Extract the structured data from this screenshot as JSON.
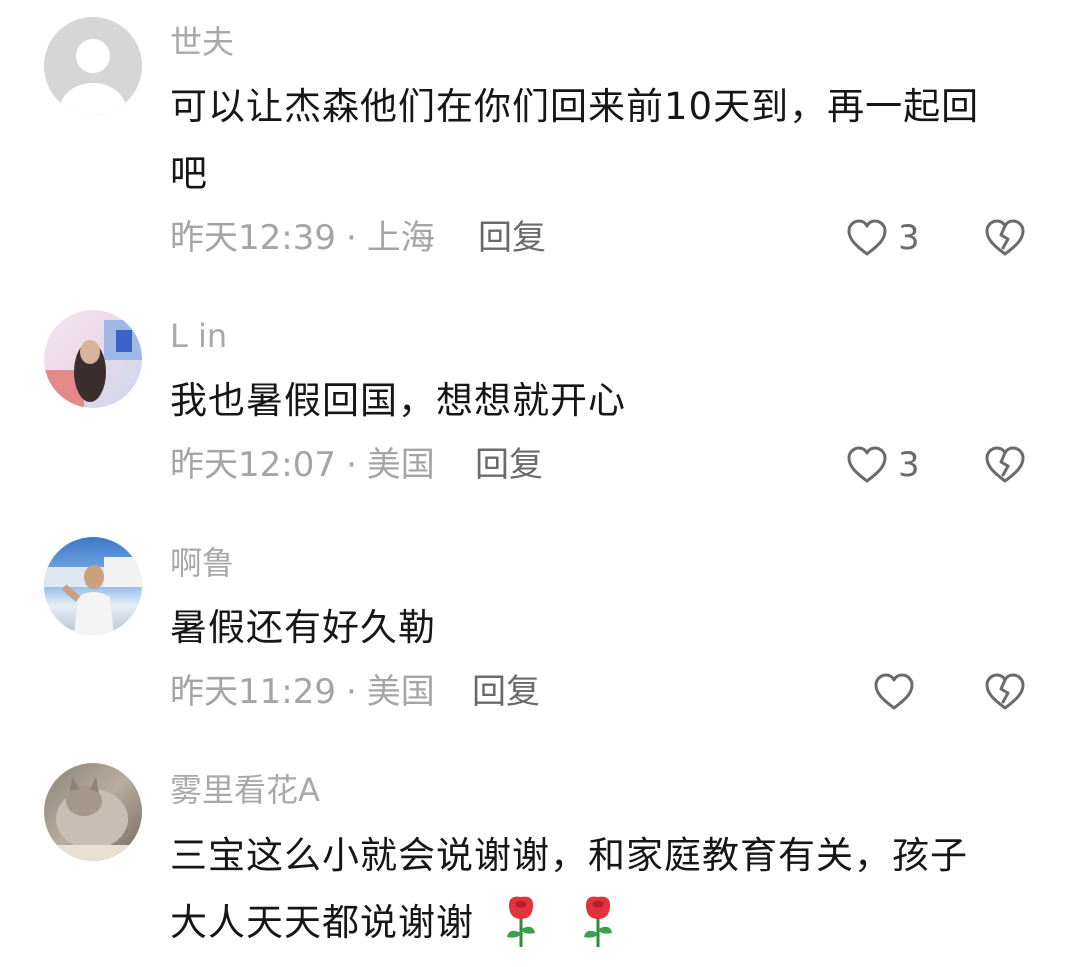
{
  "comments": [
    {
      "username": "世夫",
      "text_lines": [
        "可以让杰森他们在你们回来前10天到，再一起回",
        "吧"
      ],
      "time": "昨天12:39",
      "separator": "·",
      "location": "上海",
      "reply_label": "回复",
      "likes": "3"
    },
    {
      "username": "L in",
      "text_lines": [
        "我也暑假回国，想想就开心"
      ],
      "time": "昨天12:07",
      "separator": "·",
      "location": "美国",
      "reply_label": "回复",
      "likes": "3"
    },
    {
      "username": "啊鲁",
      "text_lines": [
        "暑假还有好久勒"
      ],
      "time": "昨天11:29",
      "separator": "·",
      "location": "美国",
      "reply_label": "回复",
      "likes": ""
    },
    {
      "username": "雾里看花A",
      "text_lines": [
        "三宝这么小就会说谢谢，和家庭教育有关，孩子",
        "大人天天都说谢谢"
      ],
      "emoji": [
        "rose-emoji",
        "rose-emoji"
      ]
    }
  ],
  "icons": {
    "like": "heart-outline-icon",
    "dislike": "broken-heart-icon"
  },
  "colors": {
    "username": "#a9a9a9",
    "text": "#161616",
    "meta": "#a5a5a5",
    "icon": "#6b6b6b"
  }
}
